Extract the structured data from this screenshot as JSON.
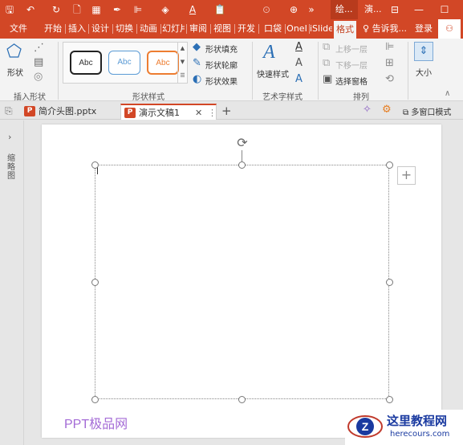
{
  "quick_access": {
    "save": "🖫",
    "undo": "↶",
    "redo": "↻",
    "new": "🗋",
    "table": "▦",
    "eyedropper": "✒",
    "align": "⊫",
    "fill": "◈",
    "font_color": "A",
    "paste": "📋",
    "more": "⊙",
    "customize": "»"
  },
  "title_tabs": {
    "drawing": "绘...",
    "presenter": "演...",
    "ellipsis": "…"
  },
  "window": {
    "ribbon_display": "⊟",
    "minimize": "—",
    "maximize": "☐"
  },
  "ribbon_tabs": [
    "文件",
    "开始",
    "插入",
    "设计",
    "切换",
    "动画",
    "幻灯片",
    "审阅",
    "视图",
    "开发",
    "口袋",
    "OneI",
    "iSlide",
    "格式"
  ],
  "active_tab": "格式",
  "tell_me": "告诉我...",
  "login": "登录",
  "ribbon": {
    "insert_shapes": {
      "shape_label": "形状",
      "group_label": "插入形状"
    },
    "shape_styles": {
      "samples": [
        "Abc",
        "Abc",
        "Abc"
      ],
      "fill": "形状填充",
      "outline": "形状轮廓",
      "effect": "形状效果",
      "group_label": "形状样式"
    },
    "art_text": {
      "quick_styles": "快速样式",
      "group_label": "艺术字样式"
    },
    "arrange": {
      "bring_forward": "上移一层",
      "send_backward": "下移一层",
      "selection_pane": "选择窗格",
      "group_label": "排列"
    },
    "size": {
      "label": "大小"
    }
  },
  "doc_tabs": [
    {
      "name": "简介头图.pptx"
    },
    {
      "name": "演示文稿1"
    }
  ],
  "doc_bar": {
    "add": "+",
    "multi_window": "多窗口模式"
  },
  "left_pane": {
    "label": "缩略图"
  },
  "watermark": "PPT极品网",
  "site_logo": {
    "name": "这里教程网",
    "url": "herecours.com"
  },
  "colors": {
    "accent": "#d24726",
    "ribbon_bg": "#f3f3f3"
  }
}
